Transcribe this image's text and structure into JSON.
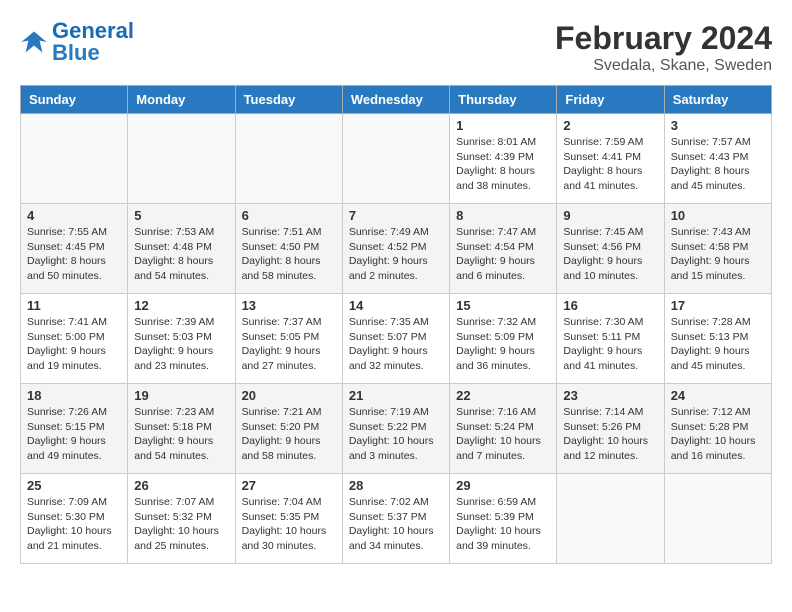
{
  "header": {
    "logo_text_general": "General",
    "logo_text_blue": "Blue",
    "main_title": "February 2024",
    "sub_title": "Svedala, Skane, Sweden"
  },
  "days_of_week": [
    "Sunday",
    "Monday",
    "Tuesday",
    "Wednesday",
    "Thursday",
    "Friday",
    "Saturday"
  ],
  "weeks": [
    [
      {
        "day": "",
        "info": ""
      },
      {
        "day": "",
        "info": ""
      },
      {
        "day": "",
        "info": ""
      },
      {
        "day": "",
        "info": ""
      },
      {
        "day": "1",
        "info": "Sunrise: 8:01 AM\nSunset: 4:39 PM\nDaylight: 8 hours\nand 38 minutes."
      },
      {
        "day": "2",
        "info": "Sunrise: 7:59 AM\nSunset: 4:41 PM\nDaylight: 8 hours\nand 41 minutes."
      },
      {
        "day": "3",
        "info": "Sunrise: 7:57 AM\nSunset: 4:43 PM\nDaylight: 8 hours\nand 45 minutes."
      }
    ],
    [
      {
        "day": "4",
        "info": "Sunrise: 7:55 AM\nSunset: 4:45 PM\nDaylight: 8 hours\nand 50 minutes."
      },
      {
        "day": "5",
        "info": "Sunrise: 7:53 AM\nSunset: 4:48 PM\nDaylight: 8 hours\nand 54 minutes."
      },
      {
        "day": "6",
        "info": "Sunrise: 7:51 AM\nSunset: 4:50 PM\nDaylight: 8 hours\nand 58 minutes."
      },
      {
        "day": "7",
        "info": "Sunrise: 7:49 AM\nSunset: 4:52 PM\nDaylight: 9 hours\nand 2 minutes."
      },
      {
        "day": "8",
        "info": "Sunrise: 7:47 AM\nSunset: 4:54 PM\nDaylight: 9 hours\nand 6 minutes."
      },
      {
        "day": "9",
        "info": "Sunrise: 7:45 AM\nSunset: 4:56 PM\nDaylight: 9 hours\nand 10 minutes."
      },
      {
        "day": "10",
        "info": "Sunrise: 7:43 AM\nSunset: 4:58 PM\nDaylight: 9 hours\nand 15 minutes."
      }
    ],
    [
      {
        "day": "11",
        "info": "Sunrise: 7:41 AM\nSunset: 5:00 PM\nDaylight: 9 hours\nand 19 minutes."
      },
      {
        "day": "12",
        "info": "Sunrise: 7:39 AM\nSunset: 5:03 PM\nDaylight: 9 hours\nand 23 minutes."
      },
      {
        "day": "13",
        "info": "Sunrise: 7:37 AM\nSunset: 5:05 PM\nDaylight: 9 hours\nand 27 minutes."
      },
      {
        "day": "14",
        "info": "Sunrise: 7:35 AM\nSunset: 5:07 PM\nDaylight: 9 hours\nand 32 minutes."
      },
      {
        "day": "15",
        "info": "Sunrise: 7:32 AM\nSunset: 5:09 PM\nDaylight: 9 hours\nand 36 minutes."
      },
      {
        "day": "16",
        "info": "Sunrise: 7:30 AM\nSunset: 5:11 PM\nDaylight: 9 hours\nand 41 minutes."
      },
      {
        "day": "17",
        "info": "Sunrise: 7:28 AM\nSunset: 5:13 PM\nDaylight: 9 hours\nand 45 minutes."
      }
    ],
    [
      {
        "day": "18",
        "info": "Sunrise: 7:26 AM\nSunset: 5:15 PM\nDaylight: 9 hours\nand 49 minutes."
      },
      {
        "day": "19",
        "info": "Sunrise: 7:23 AM\nSunset: 5:18 PM\nDaylight: 9 hours\nand 54 minutes."
      },
      {
        "day": "20",
        "info": "Sunrise: 7:21 AM\nSunset: 5:20 PM\nDaylight: 9 hours\nand 58 minutes."
      },
      {
        "day": "21",
        "info": "Sunrise: 7:19 AM\nSunset: 5:22 PM\nDaylight: 10 hours\nand 3 minutes."
      },
      {
        "day": "22",
        "info": "Sunrise: 7:16 AM\nSunset: 5:24 PM\nDaylight: 10 hours\nand 7 minutes."
      },
      {
        "day": "23",
        "info": "Sunrise: 7:14 AM\nSunset: 5:26 PM\nDaylight: 10 hours\nand 12 minutes."
      },
      {
        "day": "24",
        "info": "Sunrise: 7:12 AM\nSunset: 5:28 PM\nDaylight: 10 hours\nand 16 minutes."
      }
    ],
    [
      {
        "day": "25",
        "info": "Sunrise: 7:09 AM\nSunset: 5:30 PM\nDaylight: 10 hours\nand 21 minutes."
      },
      {
        "day": "26",
        "info": "Sunrise: 7:07 AM\nSunset: 5:32 PM\nDaylight: 10 hours\nand 25 minutes."
      },
      {
        "day": "27",
        "info": "Sunrise: 7:04 AM\nSunset: 5:35 PM\nDaylight: 10 hours\nand 30 minutes."
      },
      {
        "day": "28",
        "info": "Sunrise: 7:02 AM\nSunset: 5:37 PM\nDaylight: 10 hours\nand 34 minutes."
      },
      {
        "day": "29",
        "info": "Sunrise: 6:59 AM\nSunset: 5:39 PM\nDaylight: 10 hours\nand 39 minutes."
      },
      {
        "day": "",
        "info": ""
      },
      {
        "day": "",
        "info": ""
      }
    ]
  ]
}
